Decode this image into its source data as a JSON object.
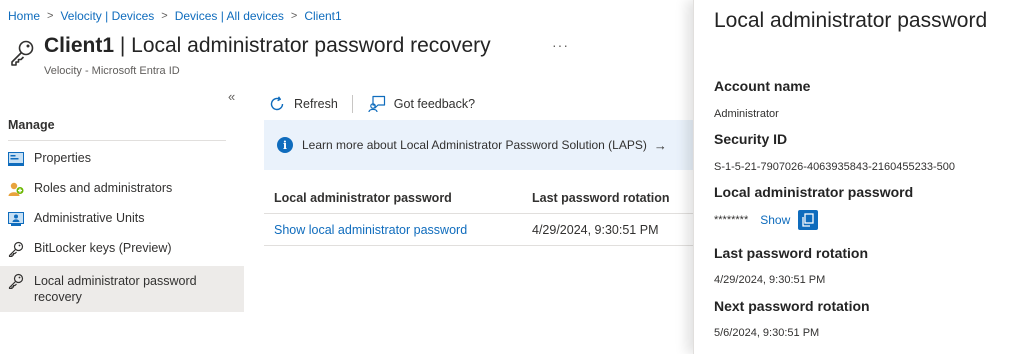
{
  "breadcrumb": [
    {
      "label": "Home"
    },
    {
      "label": "Velocity | Devices"
    },
    {
      "label": "Devices | All devices"
    },
    {
      "label": "Client1"
    }
  ],
  "header": {
    "title_bold": "Client1",
    "title_rest": " | Local administrator password recovery",
    "more_label": "···",
    "subtitle": "Velocity - Microsoft Entra ID",
    "icon": "key-icon"
  },
  "sidebar": {
    "collapse_label": "«",
    "heading": "Manage",
    "items": [
      {
        "label": "Properties",
        "icon": "properties-icon"
      },
      {
        "label": "Roles and administrators",
        "icon": "roles-icon"
      },
      {
        "label": "Administrative Units",
        "icon": "administrative-units-icon"
      },
      {
        "label": "BitLocker keys (Preview)",
        "icon": "key-icon"
      },
      {
        "label": "Local administrator password recovery",
        "icon": "key-icon",
        "selected": true
      }
    ]
  },
  "toolbar": {
    "refresh_label": "Refresh",
    "feedback_label": "Got feedback?"
  },
  "info_bar": {
    "text": "Learn more about Local Administrator Password Solution (LAPS)",
    "arrow": "→"
  },
  "table": {
    "headers": [
      "Local administrator password",
      "Last password rotation"
    ],
    "rows": [
      {
        "link": "Show local administrator password",
        "rotation": "4/29/2024, 9:30:51 PM"
      }
    ]
  },
  "panel": {
    "title": "Local administrator password",
    "account_name_label": "Account name",
    "account_name_value": "Administrator",
    "security_id_label": "Security ID",
    "security_id_value": "S-1-5-21-7907026-4063935843-2160455233-500",
    "password_label": "Local administrator password",
    "password_masked": "********",
    "show_label": "Show",
    "last_rotation_label": "Last password rotation",
    "last_rotation_value": "4/29/2024, 9:30:51 PM",
    "next_rotation_label": "Next password rotation",
    "next_rotation_value": "5/6/2024, 9:30:51 PM"
  },
  "colors": {
    "accent": "#0f6cbd",
    "info_bg": "#eaf2fb",
    "selected_bg": "#edebe9"
  }
}
